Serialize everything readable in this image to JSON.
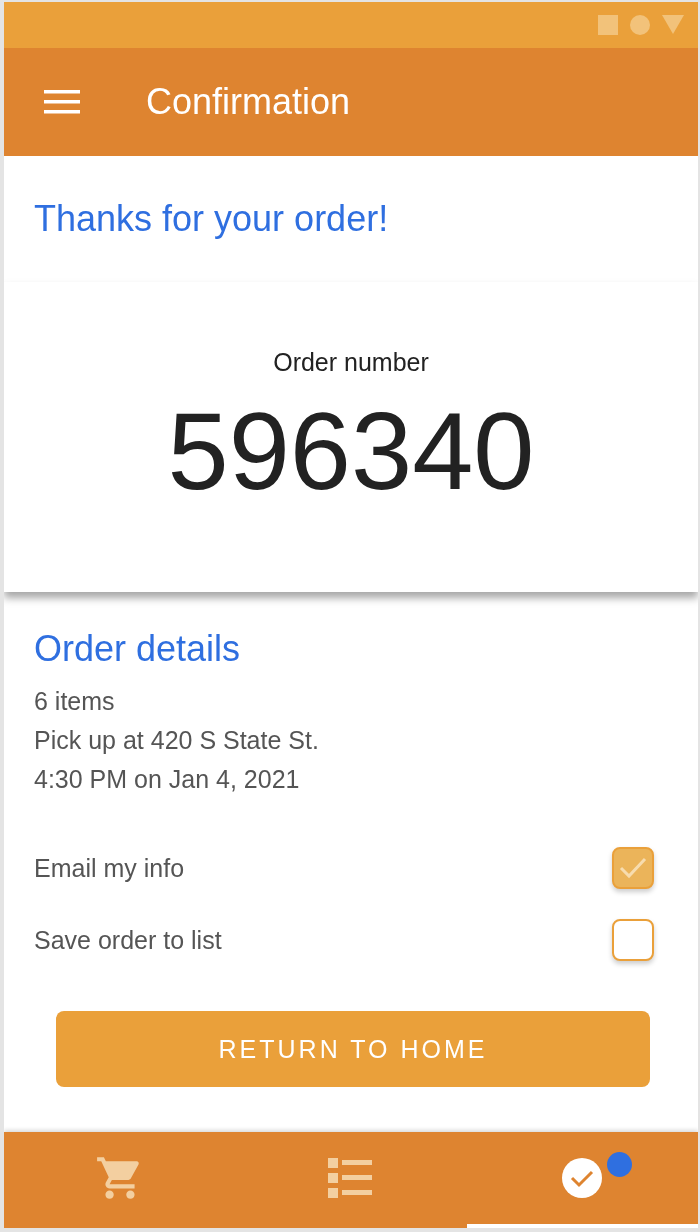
{
  "app_bar": {
    "title": "Confirmation"
  },
  "heading": "Thanks for your order!",
  "order": {
    "label": "Order number",
    "number": "596340"
  },
  "details": {
    "title": "Order details",
    "lines": [
      "6 items",
      "Pick up at 420 S State St.",
      "4:30 PM on Jan 4, 2021"
    ]
  },
  "options": [
    {
      "label": "Email my info",
      "checked": true
    },
    {
      "label": "Save order to list",
      "checked": false
    }
  ],
  "button": "RETURN TO HOME",
  "nav": [
    {
      "kind": "cart",
      "selected": false,
      "badge": false
    },
    {
      "kind": "list",
      "selected": false,
      "badge": false
    },
    {
      "kind": "check",
      "selected": true,
      "badge": true
    }
  ]
}
